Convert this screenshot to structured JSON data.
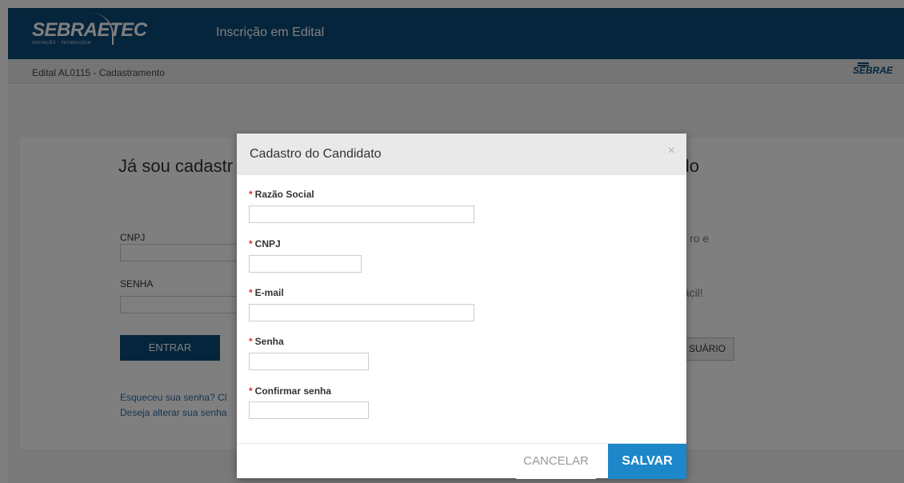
{
  "header": {
    "logo_text": "SEBRAETEC",
    "logo_tagline": "INOVAÇÃO · TECNOLOGIA",
    "title": "Inscrição em Edital"
  },
  "subheader": {
    "breadcrumb": "Edital AL0115 - Cadastramento",
    "brand": "SEBRAE"
  },
  "login": {
    "heading": "Já sou cadastr",
    "cnpj_label": "CNPJ",
    "senha_label": "SENHA",
    "enter_button": "ENTRAR",
    "forgot_link": "Esqueceu sua senha? Cl",
    "change_link": "Deseja alterar sua senha"
  },
  "register": {
    "heading": "rado",
    "text1": "ro e",
    "text2": "fácil!",
    "button": "SUÁRIO"
  },
  "modal": {
    "title": "Cadastro do Candidato",
    "close": "×",
    "required_mark": "*",
    "fields": [
      {
        "label": "Razão Social",
        "value": ""
      },
      {
        "label": "CNPJ",
        "value": ""
      },
      {
        "label": "E-mail",
        "value": ""
      },
      {
        "label": "Senha",
        "value": ""
      },
      {
        "label": "Confirmar senha",
        "value": ""
      }
    ],
    "cancel_button": "CANCELAR",
    "save_button": "SALVAR"
  },
  "colors": {
    "brand_blue": "#0b4a78",
    "save_blue": "#1c87c9",
    "required_red": "#d9362b"
  }
}
